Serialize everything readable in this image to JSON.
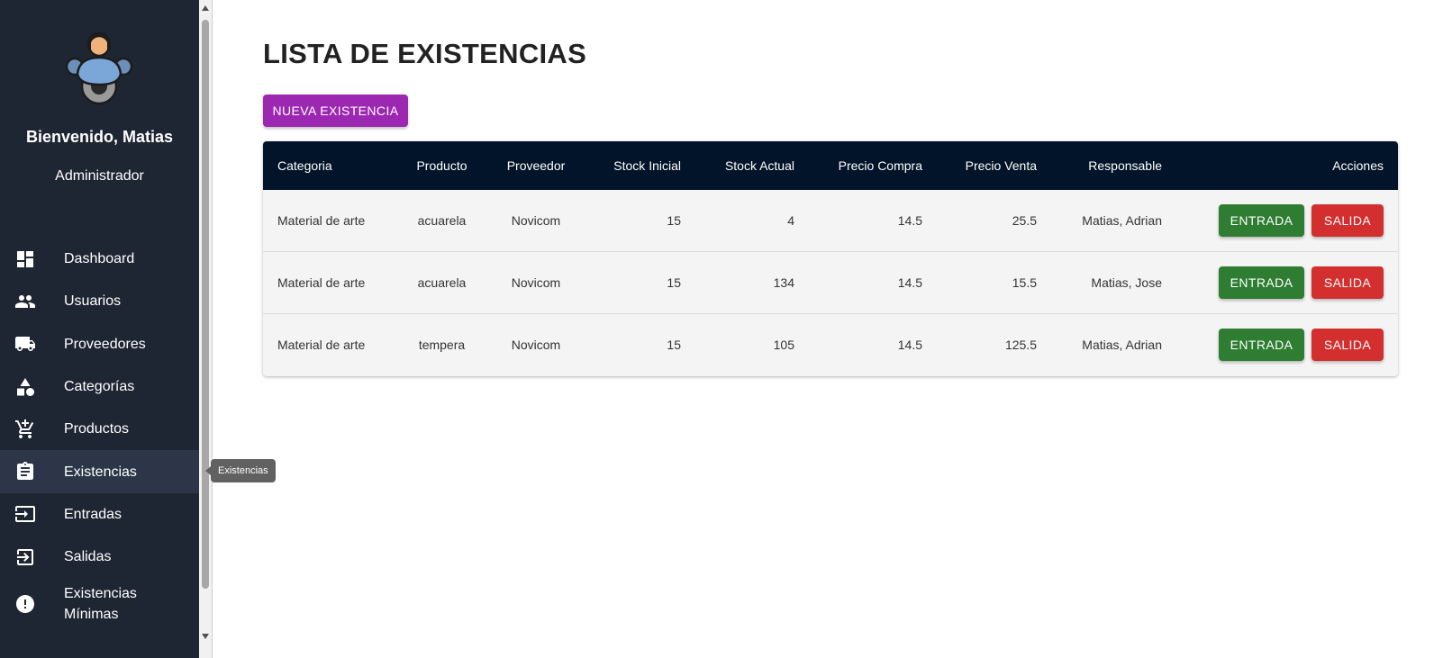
{
  "sidebar": {
    "welcome": "Bienvenido, Matias",
    "role": "Administrador",
    "items": [
      {
        "label": "Dashboard",
        "icon": "dashboard-icon"
      },
      {
        "label": "Usuarios",
        "icon": "people-icon"
      },
      {
        "label": "Proveedores",
        "icon": "truck-icon"
      },
      {
        "label": "Categorías",
        "icon": "shapes-icon"
      },
      {
        "label": "Productos",
        "icon": "cart-icon"
      },
      {
        "label": "Existencias",
        "icon": "clipboard-icon",
        "active": true
      },
      {
        "label": "Entradas",
        "icon": "login-icon"
      },
      {
        "label": "Salidas",
        "icon": "logout-icon"
      },
      {
        "label": "Existencias Mínimas",
        "icon": "alert-icon"
      }
    ]
  },
  "tooltip": "Existencias",
  "main": {
    "title": "LISTA DE EXISTENCIAS",
    "new_button": "NUEVA EXISTENCIA",
    "table": {
      "headers": [
        "Categoria",
        "Producto",
        "Proveedor",
        "Stock Inicial",
        "Stock Actual",
        "Precio Compra",
        "Precio Venta",
        "Responsable",
        "Acciones"
      ],
      "rows": [
        [
          "Material de arte",
          "acuarela",
          "Novicom",
          "15",
          "4",
          "14.5",
          "25.5",
          "Matias, Adrian"
        ],
        [
          "Material de arte",
          "acuarela",
          "Novicom",
          "15",
          "134",
          "14.5",
          "15.5",
          "Matias, Jose"
        ],
        [
          "Material de arte",
          "tempera",
          "Novicom",
          "15",
          "105",
          "14.5",
          "125.5",
          "Matias, Adrian"
        ]
      ],
      "entrada_label": "ENTRADA",
      "salida_label": "SALIDA"
    }
  },
  "colors": {
    "sidebar_bg": "#1f2633",
    "header_bg": "#021429",
    "primary_button": "#9c27b0",
    "entrada": "#2e7d32",
    "salida": "#d32f2f"
  }
}
